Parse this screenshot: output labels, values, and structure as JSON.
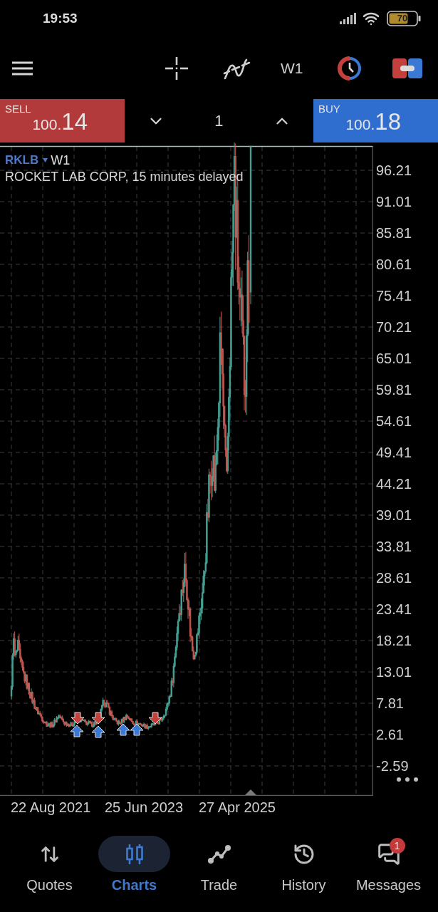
{
  "status_bar": {
    "time": "19:53",
    "battery": "70"
  },
  "toolbar": {
    "timeframe": "W1"
  },
  "trade_panel": {
    "sell": {
      "label": "SELL",
      "price_prefix": "100.",
      "price_digits": "14"
    },
    "volume": "1",
    "buy": {
      "label": "BUY",
      "price_prefix": "100.",
      "price_digits": "18"
    }
  },
  "chart": {
    "symbol": "RKLB",
    "timeframe": "W1",
    "description": "ROCKET LAB CORP, 15 minutes delayed",
    "y_axis_labels": [
      "96.21",
      "91.01",
      "85.81",
      "80.61",
      "75.41",
      "70.21",
      "65.01",
      "59.81",
      "54.61",
      "49.41",
      "44.21",
      "39.01",
      "33.81",
      "28.61",
      "23.41",
      "18.21",
      "13.01",
      "7.81",
      "2.61",
      "-2.59"
    ],
    "x_axis_labels": [
      "22 Aug 2021",
      "25 Jun 2023",
      "27 Apr 2025"
    ],
    "deal_markers": [
      {
        "kind": "sell"
      },
      {
        "kind": "buy"
      },
      {
        "kind": "sell"
      },
      {
        "kind": "buy"
      },
      {
        "kind": "buy"
      },
      {
        "kind": "buy"
      },
      {
        "kind": "sell"
      }
    ]
  },
  "bottom_nav": [
    {
      "label": "Quotes",
      "selected": false
    },
    {
      "label": "Charts",
      "selected": true
    },
    {
      "label": "Trade",
      "selected": false
    },
    {
      "label": "History",
      "selected": false
    },
    {
      "label": "Messages",
      "selected": false,
      "badge": "1"
    }
  ]
}
